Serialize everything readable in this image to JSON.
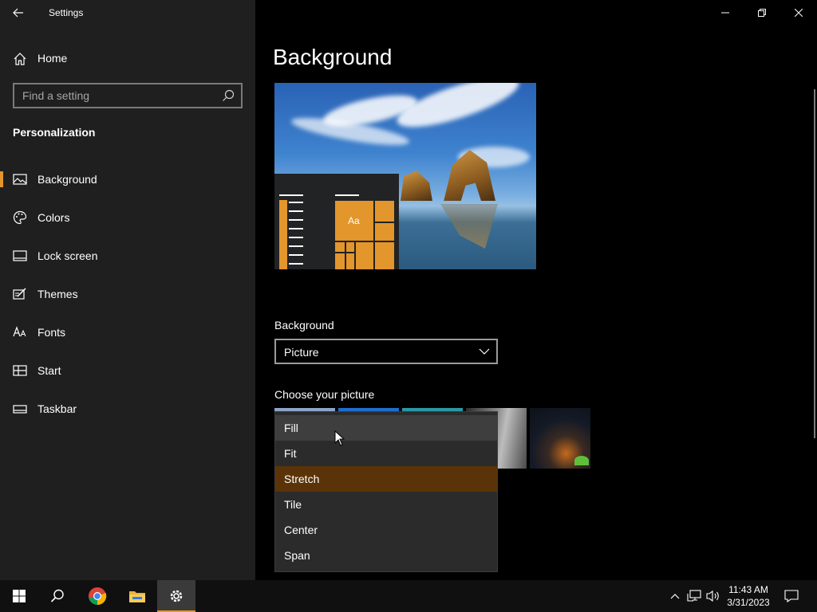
{
  "window": {
    "app_title": "Settings"
  },
  "sidebar": {
    "home_label": "Home",
    "search_placeholder": "Find a setting",
    "section_heading": "Personalization",
    "items": [
      {
        "label": "Background",
        "icon": "picture-icon",
        "active": true
      },
      {
        "label": "Colors",
        "icon": "palette-icon",
        "active": false
      },
      {
        "label": "Lock screen",
        "icon": "lock-screen-icon",
        "active": false
      },
      {
        "label": "Themes",
        "icon": "themes-icon",
        "active": false
      },
      {
        "label": "Fonts",
        "icon": "fonts-icon",
        "active": false
      },
      {
        "label": "Start",
        "icon": "start-icon",
        "active": false
      },
      {
        "label": "Taskbar",
        "icon": "taskbar-icon",
        "active": false
      }
    ]
  },
  "main": {
    "page_title": "Background",
    "preview_sample_text": "Aa",
    "background_label": "Background",
    "background_value": "Picture",
    "choose_picture_label": "Choose your picture"
  },
  "fit_dropdown": {
    "options": [
      "Fill",
      "Fit",
      "Stretch",
      "Tile",
      "Center",
      "Span"
    ],
    "hovered": "Fill",
    "selected": "Stretch"
  },
  "taskbar": {
    "time": "11:43 AM",
    "date": "3/31/2023"
  },
  "colors": {
    "accent": "#e3962b",
    "selected_option": "#5a3408"
  }
}
